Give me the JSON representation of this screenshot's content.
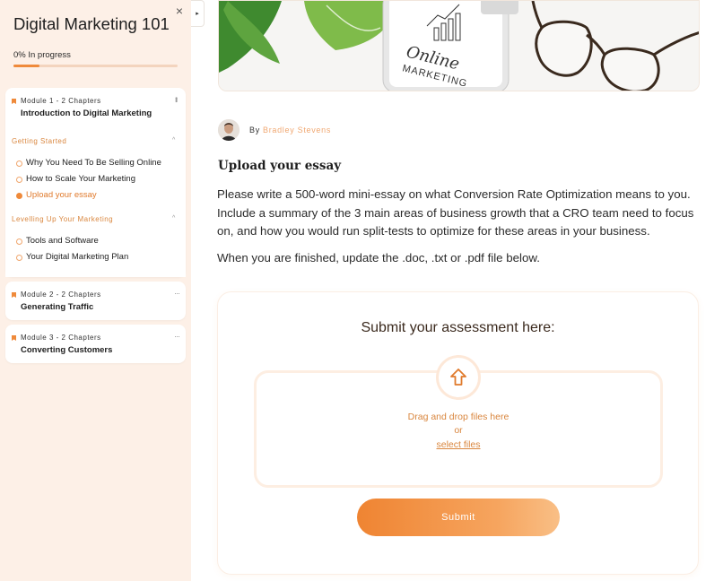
{
  "sidebar": {
    "course_title": "Digital Marketing 101",
    "progress_label": "0% In progress",
    "progress_value": 0,
    "close_icon": "×",
    "modules": [
      {
        "kicker": "Module 1  -  2 Chapters",
        "title": "Introduction to Digital Marketing",
        "sections": [
          {
            "heading": "Getting Started",
            "lessons": [
              {
                "label": "Why You Need To Be Selling Online",
                "active": false
              },
              {
                "label": "How to Scale Your Marketing",
                "active": false
              },
              {
                "label": "Upload your essay",
                "active": true
              }
            ]
          },
          {
            "heading": "Levelling Up Your Marketing",
            "lessons": [
              {
                "label": "Tools and Software",
                "active": false
              },
              {
                "label": "Your Digital Marketing Plan",
                "active": false
              }
            ]
          }
        ]
      },
      {
        "kicker": "Module 2  -  2 Chapters",
        "title": "Generating Traffic"
      },
      {
        "kicker": "Module 3  -  2 Chapters",
        "title": "Converting Customers"
      }
    ]
  },
  "author": {
    "by": "By",
    "name": "Bradley Stevens"
  },
  "hero": {
    "tablet_text": "Online",
    "tablet_text_2": "MARKETING"
  },
  "essay": {
    "title": "Upload your essay",
    "body": "Please write a 500-word mini-essay on what Conversion Rate Optimization means to you. Include a summary of the 3 main areas of business growth that a CRO team need to focus on, and how you would run split-tests to optimize for these areas in your business.",
    "note": "When you are finished, update the .doc, .txt or .pdf file below."
  },
  "submission": {
    "title": "Submit your assessment here:",
    "drag_text": "Drag and drop files here",
    "or_text": "or",
    "select_link": "select files",
    "submit_label": "Submit"
  },
  "colors": {
    "accent": "#ef8a3b",
    "sidebar_bg": "#fdf0e7"
  }
}
